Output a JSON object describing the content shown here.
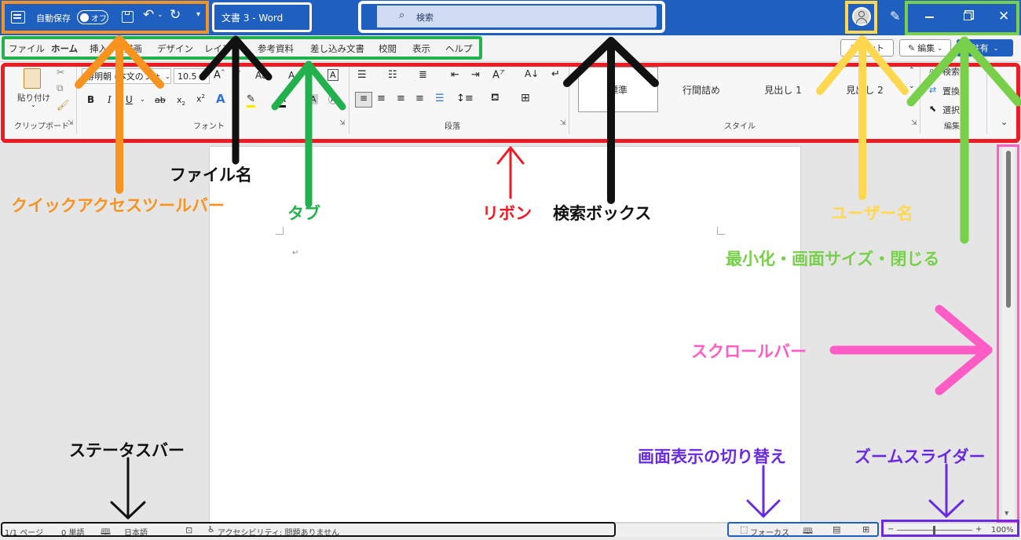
{
  "titlebar": {
    "autosave_label": "自動保存",
    "autosave_state": "オフ",
    "doc_title": "文書 3  -  Word",
    "search_placeholder": "検索"
  },
  "menu": {
    "tabs": [
      "ファイル",
      "ホーム",
      "挿入",
      "描画",
      "デザイン",
      "レイアウト",
      "参考資料",
      "差し込み文書",
      "校閲",
      "表示",
      "ヘルプ"
    ],
    "active": "ホーム",
    "comment_button": "コメント",
    "edit_button": "編集",
    "share_button": "共有"
  },
  "ribbon": {
    "clipboard": {
      "paste_label": "貼り付け",
      "group_label": "クリップボード"
    },
    "font": {
      "font_name": "游明朝 (本文のフォント)",
      "font_size": "10.5",
      "group_label": "フォント"
    },
    "paragraph": {
      "group_label": "段落"
    },
    "styles": {
      "items": [
        "標準",
        "行間詰め",
        "見出し 1",
        "見出し 2"
      ],
      "group_label": "スタイル"
    },
    "editing": {
      "find": "検索",
      "replace": "置換",
      "select": "選択",
      "group_label": "編集"
    }
  },
  "statusbar": {
    "page": "1/1 ページ",
    "words": "0 単語",
    "language": "日本語",
    "accessibility": "アクセシビリティ: 問題ありません",
    "focus": "フォーカス",
    "zoom": "100%"
  },
  "annotations": {
    "quick_access": "クイックアクセスツールバー",
    "file_name": "ファイル名",
    "tabs": "タブ",
    "ribbon": "リボン",
    "search_box": "検索ボックス",
    "user_name": "ユーザー名",
    "window_controls": "最小化・画面サイズ・閉じる",
    "scrollbar": "スクロールバー",
    "status_bar": "ステータスバー",
    "view_switch": "画面表示の切り替え",
    "zoom_slider": "ズームスライダー"
  },
  "colors": {
    "orange": "#f7931e",
    "green": "#22b14c",
    "red": "#ed1c24",
    "yellow": "#ffd84f",
    "lime": "#78d04a",
    "pink": "#ff5cc6",
    "purple": "#6a2be0",
    "black": "#111111",
    "word_blue": "#1f5fbf"
  }
}
